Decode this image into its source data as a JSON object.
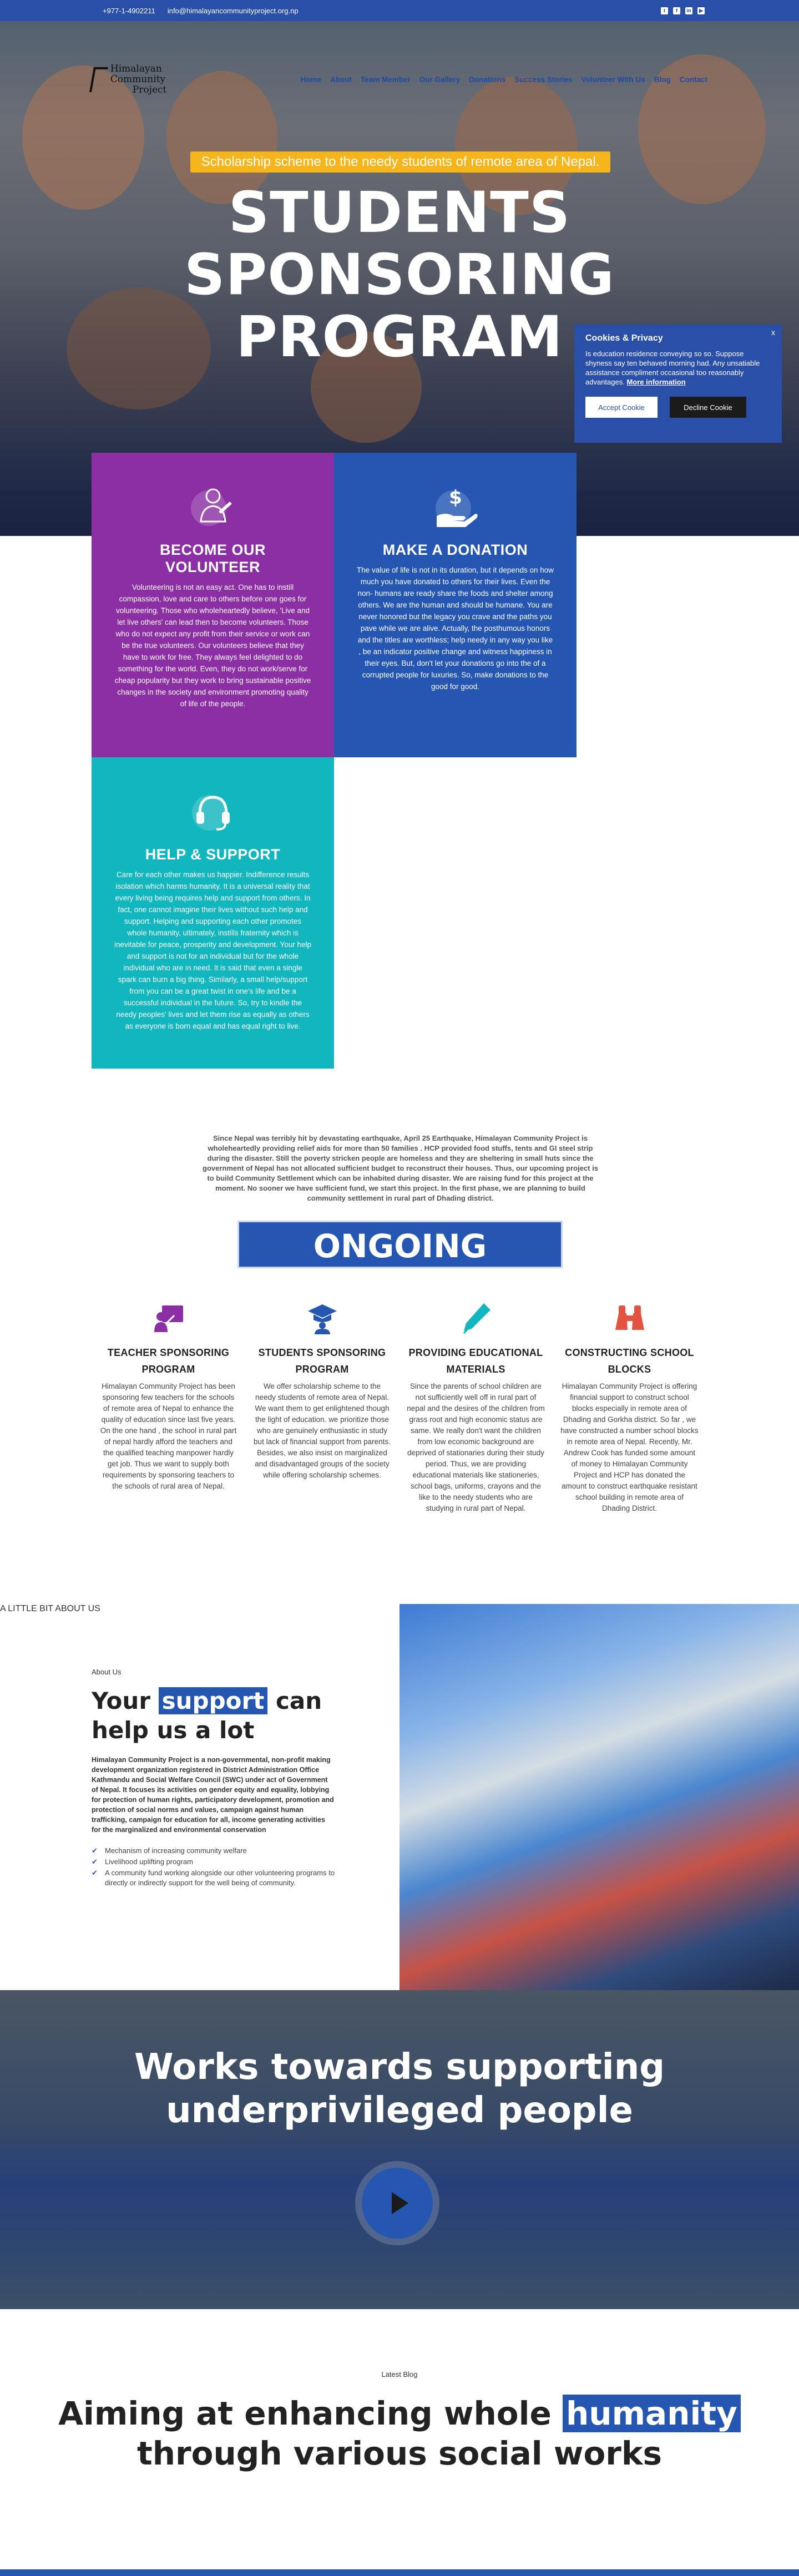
{
  "topbar": {
    "phone": "+977-1-4902211",
    "email": "info@himalayancommunityproject.org.np",
    "social": [
      "twitter-icon",
      "facebook-icon",
      "linkedin-icon",
      "youtube-icon"
    ]
  },
  "header": {
    "logo_line1": "Himalayan Community",
    "logo_line2": "Project",
    "nav": [
      "Home",
      "About",
      "Team Member",
      "Our Gallery",
      "Donations",
      "Success Stories",
      "Volunteer With Us",
      "Blog",
      "Contact"
    ]
  },
  "hero": {
    "tagline": "Scholarship scheme to the needy students of remote area of Nepal.",
    "title_l1": "STUDENTS",
    "title_l2": "SPONSORING",
    "title_l3": "PROGRAM"
  },
  "cookie": {
    "title": "Cookies & Privacy",
    "text": "Is education residence conveying so so. Suppose shyness say ten behaved morning had. Any unsatiable assistance compliment occasional too reasonably advantages.",
    "link": "More information",
    "accept": "Accept Cookie",
    "decline": "Decline Cookie",
    "close": "x"
  },
  "cards": [
    {
      "title": "BECOME OUR VOLUNTEER",
      "text": "Volunteering is not an easy act. One has to instill compassion, love and care to others before one goes for volunteering. Those who wholeheartedly believe, 'Live and let live others' can lead then to become volunteers. Those who do not expect any profit from their service or work can be the true volunteers. Our volunteers believe that they have to work for free. They always feel delighted to do something for the world. Even, they do not work/serve for cheap popularity but they work to bring sustainable positive changes in the society and environment promoting quality of life of the people."
    },
    {
      "title": "MAKE A DONATION",
      "text": "The value of life is not in its duration, but it depends on how much you have donated to others for their lives. Even the non- humans are ready share the foods and shelter among others. We are the human and should be humane. You are never honored but the legacy you crave and the paths you pave while we are alive. Actually, the posthumous honors and the titles are worthless; help needy in any way you like , be an indicator positive change and witness happiness in their eyes. But, don't let your donations go into the of a corrupted people for luxuries. So, make donations to the good for good."
    },
    {
      "title": "HELP & SUPPORT",
      "text": "Care for each other makes us happier. Indifference results isolation which harms humanity. It is a universal reality that every living being requires help and support from others. In fact, one cannot imagine their lives without such help and support. Helping and supporting each other promotes whole humanity, ultimately, instills fraternity which is inevitable for peace, prosperity and development. Your help and support is not for an individual but for the whole individual who are in need. It is said that even a single spark can burn a big thing. Similarly, a small help/support from you can be a great twist in one's life and be a successful individual in the future. So, try to kindle the needy peoples' lives and let them rise as equally as others as everyone is born equal and has equal right to live."
    }
  ],
  "intro": "Since Nepal was terribly hit by devastating earthquake, April 25 Earthquake, Himalayan Community Project is wholeheartedly providing relief aids for more than 50 families . HCP provided food stuffs, tents and GI steel strip during the disaster. Still the poverty stricken people are homeless and they are sheltering in small huts since the government of Nepal has not allocated sufficient budget to reconstruct their houses. Thus, our upcoming project is to build Community Settlement which can be inhabited during disaster. We are raising fund for this project at the moment. No sooner we have sufficient fund, we start this project. In the first phase, we are planning to build community settlement in rural part of Dhading district.",
  "ongoing": "ONGOING PROJECTS",
  "projects": [
    {
      "icon": "teacher-icon",
      "color": "#8c2fa4",
      "title_l1": "TEACHER SPONSORING",
      "title_l2": "PROGRAM",
      "text": "Himalayan Community Project has been sponsoring few teachers for the schools of remote area of Nepal to enhance the quality of education since last five years. On the one hand , the school in rural part of nepal hardly afford the teachers and the qualified teaching manpower hardly get job. Thus we want to supply both requirements by sponsoring teachers to the schools of rural area of Nepal."
    },
    {
      "icon": "graduation-icon",
      "color": "#2456b2",
      "title_l1": "STUDENTS SPONSORING",
      "title_l2": "PROGRAM",
      "text": "We offer scholarship scheme to the needy students of remote area of Nepal. We want them to get enlightened though the light of education. we prioritize those who are genuinely enthusiastic in study but lack of financial support from parents. Besides, we also insist on marginalized and disadvantaged groups of the society while offering scholarship schemes."
    },
    {
      "icon": "pen-icon",
      "color": "#11b6be",
      "title_l1": "PROVIDING EDUCATIONAL",
      "title_l2": "MATERIALS",
      "text": "Since the parents of school children are not sufficiently well off in rural part of nepal and the desires of the children from grass root and high economic status are same. We really don't want the children from low economic background are deprived of stationaries during their study period. Thus, we are providing educational materials like stationeries, school bags, uniforms, crayons and the like to the needy students who are studying in rural part of Nepal."
    },
    {
      "icon": "binoculars-icon",
      "color": "#e4533f",
      "title_l1": "CONSTRUCTING SCHOOL",
      "title_l2": "BLOCKS",
      "text": "Himalayan Community Project is offering financial support to construct school blocks especially in remote area of Dhading and Gorkha district. So far , we have constructed a number school blocks in remote area of Nepal. Recently, Mr. Andrew Cook has funded some amount of money to Himalayan Community Project and HCP has donated the amount to construct earthquake resistant school building in remote area of Dhading District."
    }
  ],
  "about": {
    "label": "About Us",
    "title_pre": "Your ",
    "title_hl": "support",
    "title_post": " can help us a lot",
    "desc": "Himalayan Community Project is a non-governmental, non-profit making development organization registered in District Administration Office Kathmandu and Social Welfare Council (SWC) under act of Government of Nepal. It focuses its activities on gender equity and equality, lobbying for protection of human rights, participatory development, promotion and protection of social norms and values, campaign against human trafficking, campaign for education for all, income generating activities for the marginalized and environmental conservation",
    "list": [
      "Mechanism of increasing community welfare",
      "Livelihood uplifting program",
      "A community fund working alongside our other volunteering programs to directly or indirectly support for the well being of community."
    ],
    "badge": "A LITTLE BIT ABOUT US"
  },
  "works": {
    "title_l1": "Works towards supporting",
    "title_l2": "underprivileged people"
  },
  "blog": {
    "label": "Latest Blog",
    "pre": "Aiming at enhancing whole ",
    "hl": "humanity",
    "line2": "through various social works"
  }
}
